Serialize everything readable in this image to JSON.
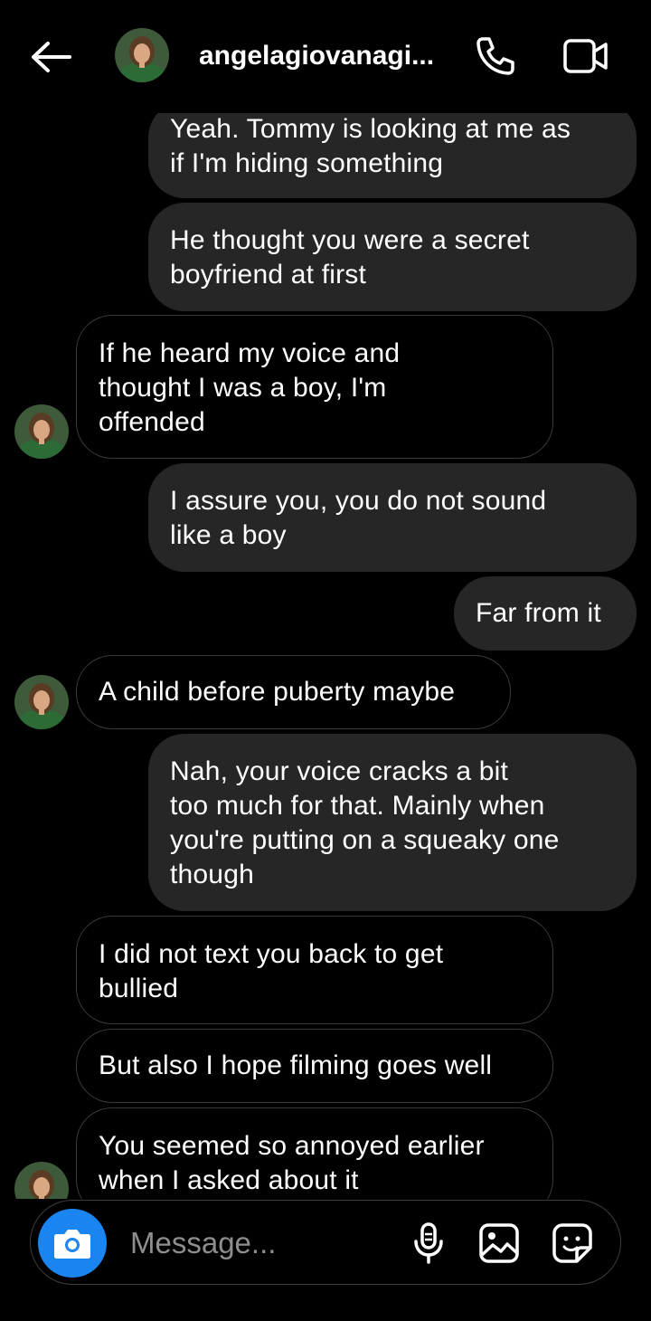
{
  "header": {
    "contact_name": "angelagiovanagi...",
    "back_icon": "arrow-left-icon",
    "call_icon": "phone-icon",
    "video_icon": "video-camera-icon"
  },
  "messages": [
    {
      "sender": "me",
      "text": "Yeah. Tommy is looking at me as\nif I'm hiding something"
    },
    {
      "sender": "me",
      "text": "He thought you were a secret\nboyfriend at first"
    },
    {
      "sender": "them",
      "text": "If he heard my voice and\nthought I was a boy, I'm\noffended"
    },
    {
      "sender": "me",
      "text": "I assure you, you do not sound\nlike a boy"
    },
    {
      "sender": "me",
      "text": "Far from it"
    },
    {
      "sender": "them",
      "text": "A child before puberty maybe"
    },
    {
      "sender": "me",
      "text": "Nah, your voice cracks a bit\ntoo much for that. Mainly when\nyou're putting on a squeaky one\nthough"
    },
    {
      "sender": "them",
      "text": "I did not text you back to get\nbullied"
    },
    {
      "sender": "them",
      "text": "But also I hope filming goes well"
    },
    {
      "sender": "them",
      "text": "You seemed so annoyed earlier\nwhen I asked about it"
    }
  ],
  "composer": {
    "placeholder": "Message...",
    "camera_icon": "camera-icon",
    "mic_icon": "microphone-icon",
    "gallery_icon": "image-icon",
    "sticker_icon": "sticker-icon"
  },
  "colors": {
    "background": "#000000",
    "outgoing_bubble": "#262626",
    "incoming_border": "#3a3a3a",
    "camera_button": "#1a84f0",
    "placeholder": "#8e8e8e"
  }
}
